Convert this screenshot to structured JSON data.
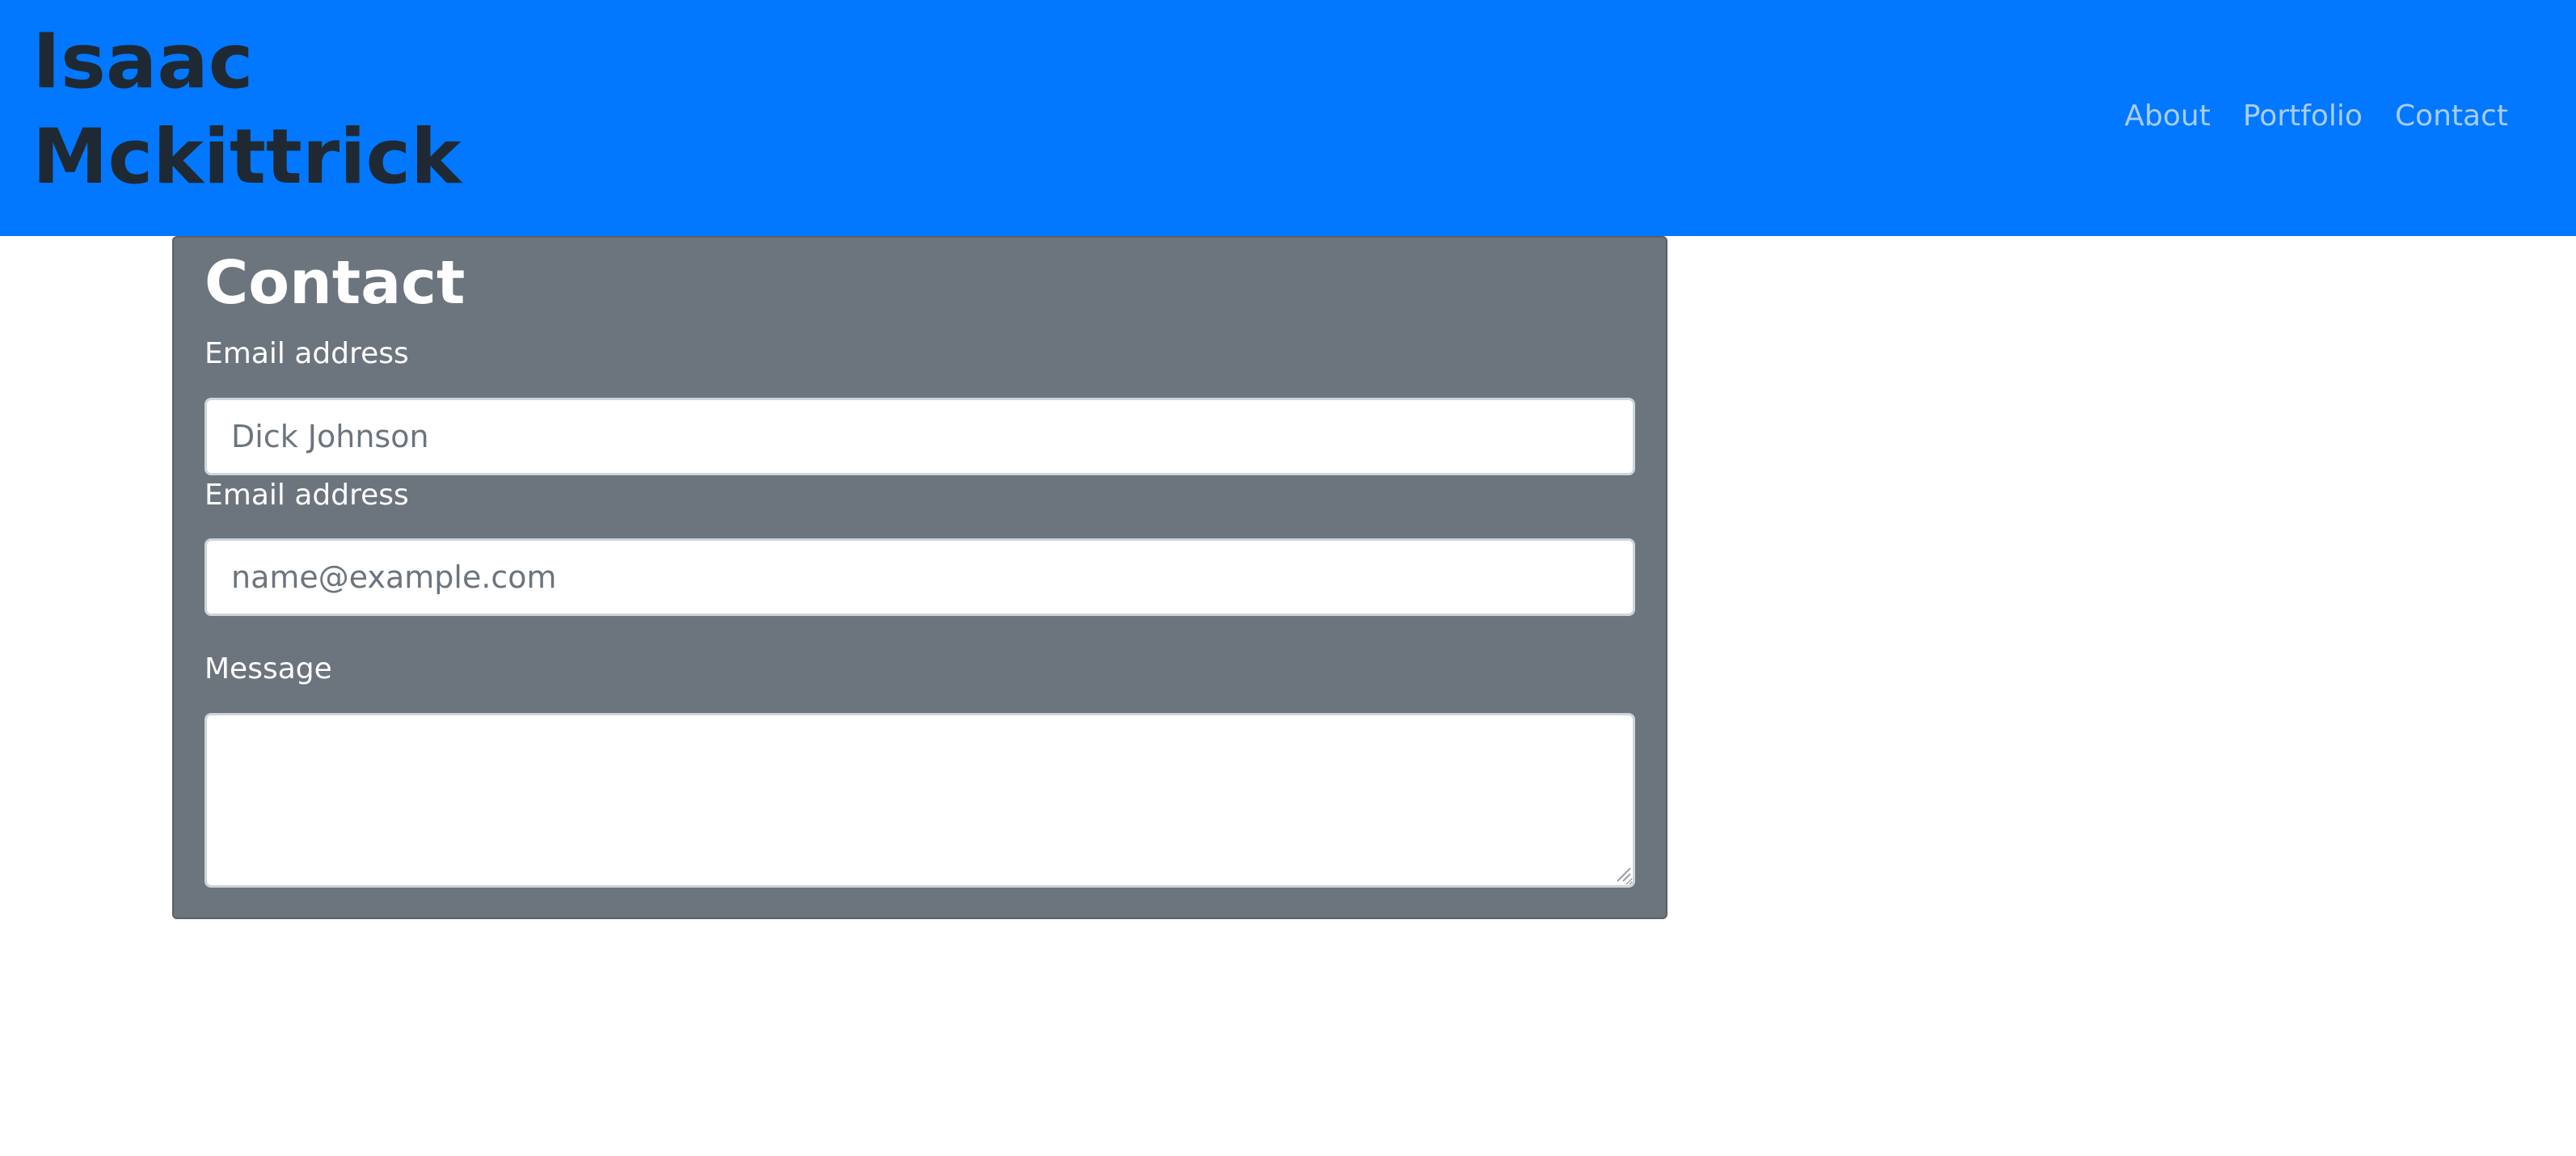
{
  "header": {
    "brand_line1": "Isaac",
    "brand_line2": "Mckittrick",
    "nav": [
      {
        "label": "About"
      },
      {
        "label": "Portfolio"
      },
      {
        "label": "Contact"
      }
    ],
    "background_color": "#0178ff"
  },
  "contact_card": {
    "title": "Contact",
    "background_color": "#6c757d",
    "fields": [
      {
        "label": "Email address",
        "value": "",
        "placeholder": "Dick Johnson"
      },
      {
        "label": "Email address",
        "value": "",
        "placeholder": "name@example.com"
      },
      {
        "label": "Message",
        "value": "",
        "placeholder": ""
      }
    ]
  },
  "icons": [
    "textarea-resize-grip-icon"
  ]
}
